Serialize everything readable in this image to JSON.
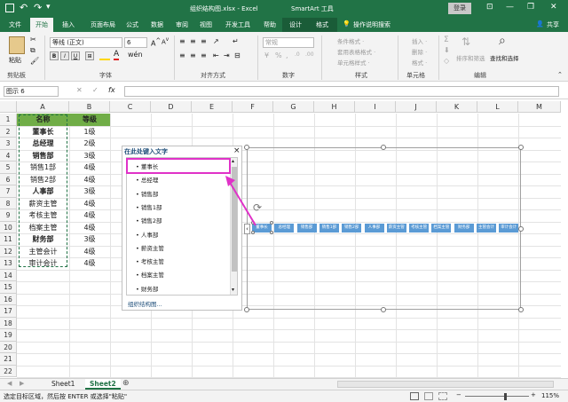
{
  "titlebar": {
    "title": "组织结构图.xlsx - Excel",
    "context_tool": "SmartArt 工具",
    "login": "登录",
    "minimize": "—",
    "restore": "❐",
    "close": "✕",
    "ribbon_opts": "⊡"
  },
  "tabs": [
    "文件",
    "开始",
    "插入",
    "页面布局",
    "公式",
    "数据",
    "审阅",
    "视图",
    "开发工具",
    "帮助",
    "设计",
    "格式"
  ],
  "tell_me": "操作说明搜索",
  "share": "共享",
  "ribbon": {
    "paste": "粘贴",
    "font_name": "等线 (正文)",
    "font_size": "6",
    "number_format": "常规",
    "cond_format": "条件格式 ·",
    "table_format": "套用表格格式 ·",
    "cell_style": "单元格样式 ·",
    "insert": "插入 ·",
    "delete": "删除 ·",
    "format": "格式 ·",
    "sort_filter": "排序和筛选",
    "find_select": "查找和选择",
    "groups": [
      "剪贴板",
      "字体",
      "对齐方式",
      "数字",
      "样式",
      "单元格",
      "编辑"
    ]
  },
  "formula_bar": {
    "name_box": "图示 6",
    "fx": "fx",
    "cancel": "✕",
    "enter": "✓",
    "formula": ""
  },
  "grid": {
    "columns": [
      "A",
      "B",
      "C",
      "D",
      "E",
      "F",
      "G",
      "H",
      "I",
      "J",
      "K",
      "L",
      "M"
    ],
    "rows": [
      "1",
      "2",
      "3",
      "4",
      "5",
      "6",
      "7",
      "8",
      "9",
      "10",
      "11",
      "12",
      "13",
      "14",
      "15",
      "16",
      "17",
      "18",
      "19",
      "20",
      "21",
      "22"
    ],
    "cells": [
      [
        "名称",
        "等级"
      ],
      [
        "董事长",
        "1级"
      ],
      [
        "总经理",
        "2级"
      ],
      [
        "销售部",
        "3级"
      ],
      [
        "销售1部",
        "4级"
      ],
      [
        "销售2部",
        "4级"
      ],
      [
        "人事部",
        "3级"
      ],
      [
        "薪资主管",
        "4级"
      ],
      [
        "考核主管",
        "4级"
      ],
      [
        "档案主管",
        "4级"
      ],
      [
        "财务部",
        "3级"
      ],
      [
        "主管会计",
        "4级"
      ],
      [
        "审计会计",
        "4级"
      ]
    ],
    "header_fill": "#70ad47"
  },
  "text_pane": {
    "title": "在此处键入文字",
    "close": "×",
    "items": [
      "董事长",
      "总经理",
      "销售部",
      "销售1部",
      "销售2部",
      "人事部",
      "薪资主管",
      "考核主管",
      "档案主管",
      "财务部"
    ],
    "footer": "组织结构图..."
  },
  "smartart": {
    "shapes": [
      "董事长",
      "总经理",
      "销售部",
      "销售1部",
      "销售2部",
      "人事部",
      "薪资主管",
      "考核主管",
      "档案主管",
      "财务部",
      "主管会计",
      "审计会计"
    ],
    "fill": "#5b9bd5",
    "expand": "‹",
    "rotate_icon": "rotate-handle"
  },
  "annotation_color": "#e032c8",
  "sheets": [
    "Sheet1",
    "Sheet2"
  ],
  "active_sheet": "Sheet2",
  "status": {
    "text": "选定目标区域，然后按 ENTER 或选择\"粘贴\"",
    "zoom": "115%",
    "minus": "−",
    "plus": "+"
  }
}
